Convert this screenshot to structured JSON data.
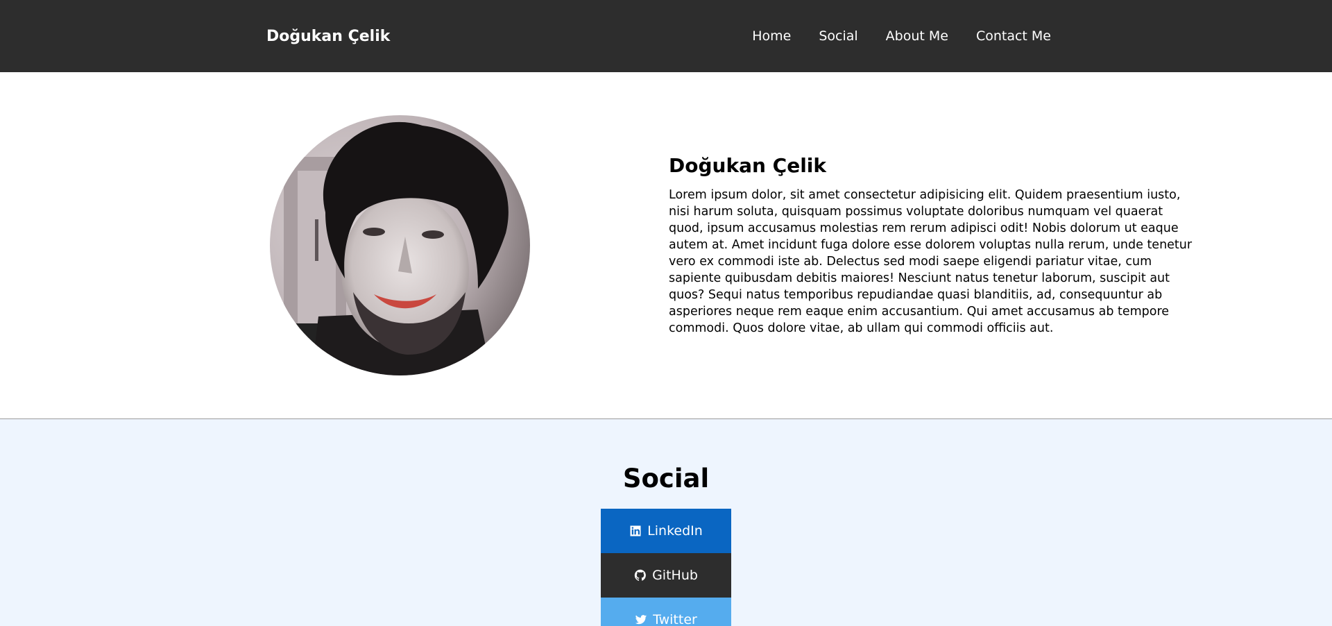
{
  "header": {
    "brand": "Doğukan Çelik",
    "nav": [
      "Home",
      "Social",
      "About Me",
      "Contact Me"
    ]
  },
  "about": {
    "avatar_icon": "profile-photo",
    "name": "Doğukan Çelik",
    "body": "Lorem ipsum dolor, sit amet consectetur adipisicing elit. Quidem praesentium iusto, nisi harum soluta, quisquam possimus voluptate doloribus numquam vel quaerat quod, ipsum accusamus molestias rem rerum adipisci odit! Nobis dolorum ut eaque autem at. Amet incidunt fuga dolore esse dolorem voluptas nulla rerum, unde tenetur vero ex commodi iste ab. Delectus sed modi saepe eligendi pariatur vitae, cum sapiente quibusdam debitis maiores! Nesciunt natus tenetur laborum, suscipit aut quos? Sequi natus temporibus repudiandae quasi blanditiis, ad, consequuntur ab asperiores neque rem eaque enim accusantium. Qui amet accusamus ab tempore commodi. Quos dolore vitae, ab ullam qui commodi officiis aut."
  },
  "social": {
    "title": "Social",
    "links": [
      {
        "label": "LinkedIn",
        "icon": "linkedin-icon",
        "color": "#0a66c2"
      },
      {
        "label": "GitHub",
        "icon": "github-icon",
        "color": "#2d2d2d"
      },
      {
        "label": "Twitter",
        "icon": "twitter-icon",
        "color": "#55acee"
      }
    ]
  },
  "colors": {
    "navbar": "#2d2d2d",
    "social_bg": "#eef5fe"
  }
}
